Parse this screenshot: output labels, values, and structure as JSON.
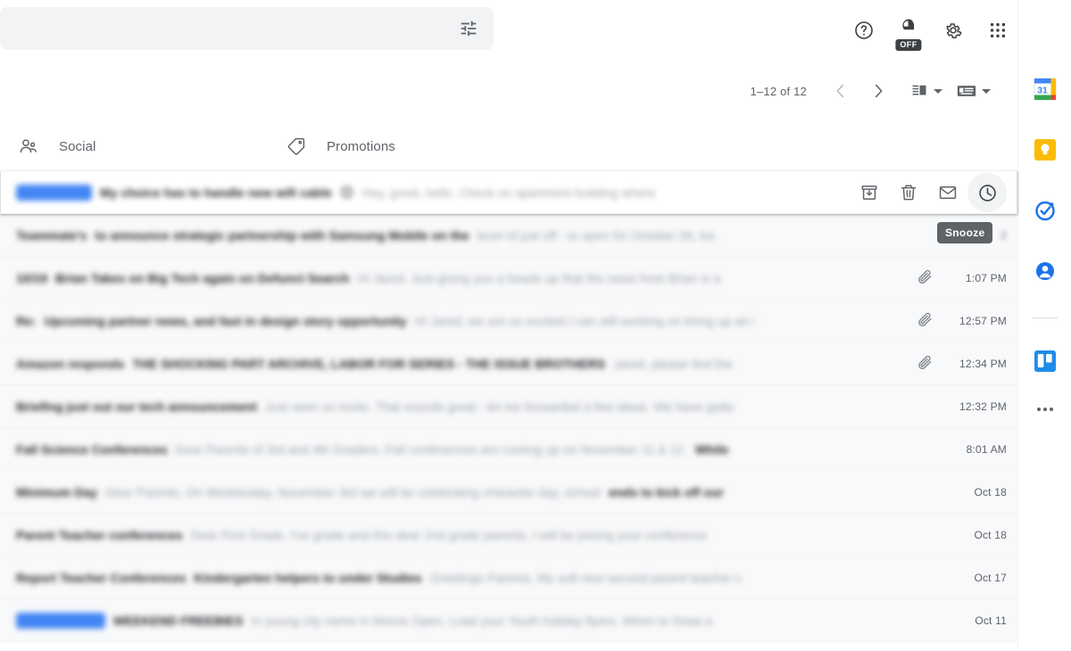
{
  "search": {
    "value": "",
    "placeholder": "",
    "options_icon": "tune-icon"
  },
  "header": {
    "help_icon": "help-icon",
    "support_icon": "off-toggle-icon",
    "off_label": "OFF",
    "settings_icon": "gear-icon",
    "apps_icon": "apps-grid-icon",
    "avatar": "profile-avatar"
  },
  "toolbar": {
    "page_range": "1–12 of 12",
    "prev_icon": "chevron-left-icon",
    "next_icon": "chevron-right-icon",
    "split_pane_icon": "split-pane-icon",
    "input_tools_icon": "keyboard-icon"
  },
  "tabs": [
    {
      "label": "Social",
      "icon": "people-icon",
      "active": false
    },
    {
      "label": "Promotions",
      "icon": "tag-icon",
      "active": false
    }
  ],
  "hover_actions": {
    "archive": "archive-icon",
    "delete": "delete-icon",
    "mark_unread": "mark-unread-icon",
    "snooze": "snooze-clock-icon",
    "tooltip": "Snooze"
  },
  "messages": [
    {
      "sender": "Mary Jones",
      "sender_highlighted": true,
      "subject": "My choice has to handle new wifi cable",
      "emoji": "😊",
      "snippet": "Hey, great, hello. Check on apartment building where",
      "time": "",
      "attachment": false,
      "state": "hovered"
    },
    {
      "sender": "Teammate's",
      "sender_highlighted": false,
      "subject": "to announce strategic partnership with Samsung Mobile on the",
      "snippet": "level of just off - to open for October 26, tra",
      "time": "2",
      "attachment": false,
      "state": "tinted"
    },
    {
      "sender": "10/19",
      "sender_highlighted": false,
      "subject": "Brian Takes on Big Tech again on Defunct Search",
      "snippet": "Hi Jared, Just giving you a heads up that the news from Brian is a",
      "time": "1:07 PM",
      "attachment": true,
      "state": "tinted"
    },
    {
      "sender": "Re:",
      "sender_highlighted": false,
      "subject": "Upcoming partner news, and fast in design story opportunity",
      "snippet": "Hi Jared, we are so excited I can still working on lining up an i",
      "time": "12:57 PM",
      "attachment": true,
      "state": "tinted"
    },
    {
      "sender": "Amazon responds",
      "sender_highlighted": false,
      "subject": "THE SHOCKING PART ARCHIVE, LABOR FOR SERIES - THE ISSUE BROTHERS",
      "snippet": "Jared, please find the",
      "time": "12:34 PM",
      "attachment": true,
      "state": "tinted"
    },
    {
      "sender": "Briefing just out our tech announcement",
      "sender_highlighted": false,
      "subject": "",
      "snippet": "Just seen on invite. That sounds great - let me forwarded a few ideas. We have gotte",
      "time": "12:32 PM",
      "attachment": false,
      "state": "tinted"
    },
    {
      "sender": "Fall Science Conferences",
      "sender_highlighted": false,
      "subject": "",
      "snippet": "Dear Parents of 3rd and 4th Graders, Fall conferences are coming up on November 11 & 12.",
      "bold_tail": "While",
      "time": "8:01 AM",
      "attachment": false,
      "state": "tinted"
    },
    {
      "sender": "Minimum Day",
      "sender_highlighted": false,
      "subject": "",
      "snippet": "Dear Parents, On Wednesday, November 3rd we will be celebrating character day, school",
      "bold_tail": "ends to kick off our",
      "time": "Oct 18",
      "attachment": false,
      "state": "tinted"
    },
    {
      "sender": "Parent Teacher conferences",
      "sender_highlighted": false,
      "subject": "",
      "snippet": "Dear First Grade, I've grade and this dear 2nd grade parents, I will be joining your conference",
      "time": "Oct 18",
      "attachment": false,
      "state": "tinted"
    },
    {
      "sender": "Report Teacher Conferences",
      "sender_highlighted": false,
      "subject": "Kindergarten helpers to under Studies",
      "snippet": "Greetings Parents, My soft new second parent teacher c",
      "time": "Oct 17",
      "attachment": false,
      "state": "tinted"
    },
    {
      "sender": "Costa Kramer",
      "sender_highlighted": true,
      "subject": "WEEKEND FREEBIES",
      "snippet": "In young city name in Moore Open. Load your Youth holiday flyers. When to Draw a",
      "time": "Oct 11",
      "attachment": false,
      "state": "tinted"
    }
  ],
  "side_panel": {
    "items": [
      {
        "name": "calendar-icon",
        "label": "Calendar",
        "badge": "31"
      },
      {
        "name": "keep-icon",
        "label": "Keep"
      },
      {
        "name": "tasks-icon",
        "label": "Tasks"
      },
      {
        "name": "contacts-icon",
        "label": "Contacts"
      },
      {
        "name": "addon-board-icon",
        "label": "Add-on"
      }
    ],
    "more_icon": "more-options-icon"
  },
  "colors": {
    "accent_blue": "#4285f4",
    "tooltip_bg": "#5f6368",
    "search_bg": "#f1f3f4",
    "row_tint": "#f8f9fa",
    "text_secondary": "#5f6368",
    "emoji_yellow": "#f5b400"
  }
}
